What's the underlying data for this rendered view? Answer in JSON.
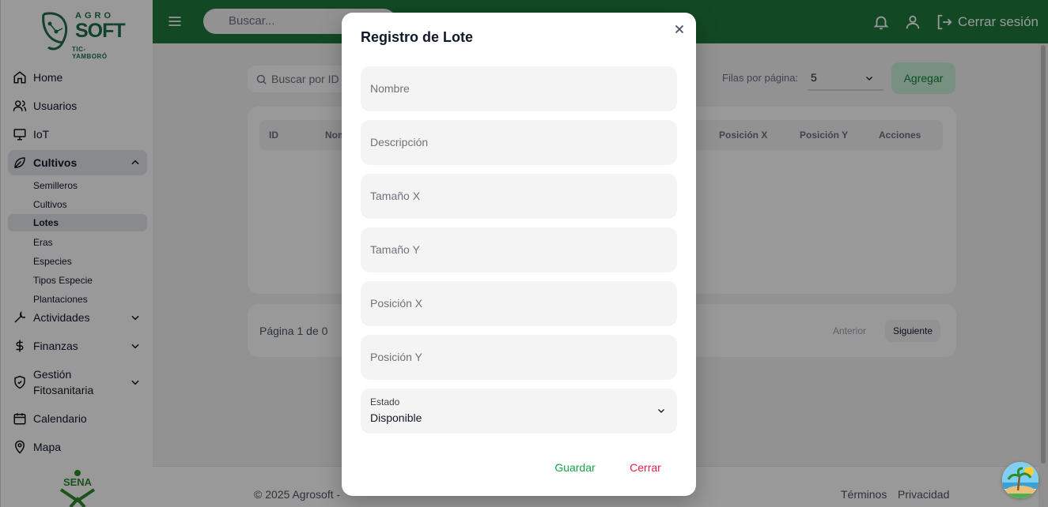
{
  "brand": {
    "top": "AGRO",
    "name": "SOFT",
    "sub": "TIC-YAMBORÓ",
    "footer_logo": "SENA"
  },
  "sidebar": {
    "items": [
      {
        "label": "Home",
        "icon": "home-icon"
      },
      {
        "label": "Usuarios",
        "icon": "users-icon"
      },
      {
        "label": "IoT",
        "icon": "monitor-icon"
      },
      {
        "label": "Cultivos",
        "icon": "leaf-icon"
      },
      {
        "label": "Actividades",
        "icon": "wrench-icon"
      },
      {
        "label": "Finanzas",
        "icon": "dollar-icon"
      },
      {
        "label": "Gestión Fitosanitaria",
        "icon": "shield-icon"
      },
      {
        "label": "Calendario",
        "icon": "calendar-icon"
      },
      {
        "label": "Mapa",
        "icon": "map-pin-icon"
      }
    ],
    "cultivos_sub": [
      "Semilleros",
      "Cultivos",
      "Lotes",
      "Eras",
      "Especies",
      "Tipos Especie",
      "Plantaciones"
    ]
  },
  "topbar": {
    "search_placeholder": "Buscar...",
    "logout_label": "Cerrar sesión"
  },
  "content": {
    "search_placeholder": "Buscar por ID",
    "rows_label": "Filas por página:",
    "rows_value": "5",
    "add_label": "Agregar",
    "columns": [
      "ID",
      "Nombre",
      "Posición X",
      "Posición Y",
      "Acciones"
    ],
    "page_text": "Página 1 de 0",
    "prev_label": "Anterior",
    "next_label": "Siguiente",
    "footer_copy": "© 2025 Agrosoft -",
    "footer_terms": "Términos",
    "footer_privacy": "Privacidad"
  },
  "modal": {
    "title": "Registro de Lote",
    "fields": [
      {
        "placeholder": "Nombre"
      },
      {
        "placeholder": "Descripción"
      },
      {
        "placeholder": "Tamaño X"
      },
      {
        "placeholder": "Tamaño Y"
      },
      {
        "placeholder": "Posición X"
      },
      {
        "placeholder": "Posición Y"
      }
    ],
    "estado": {
      "label": "Estado",
      "value": "Disponible"
    },
    "save_label": "Guardar",
    "close_label": "Cerrar"
  },
  "colors": {
    "primary": "#1e7a3c",
    "save": "#16a34a",
    "close": "#e11d48"
  }
}
